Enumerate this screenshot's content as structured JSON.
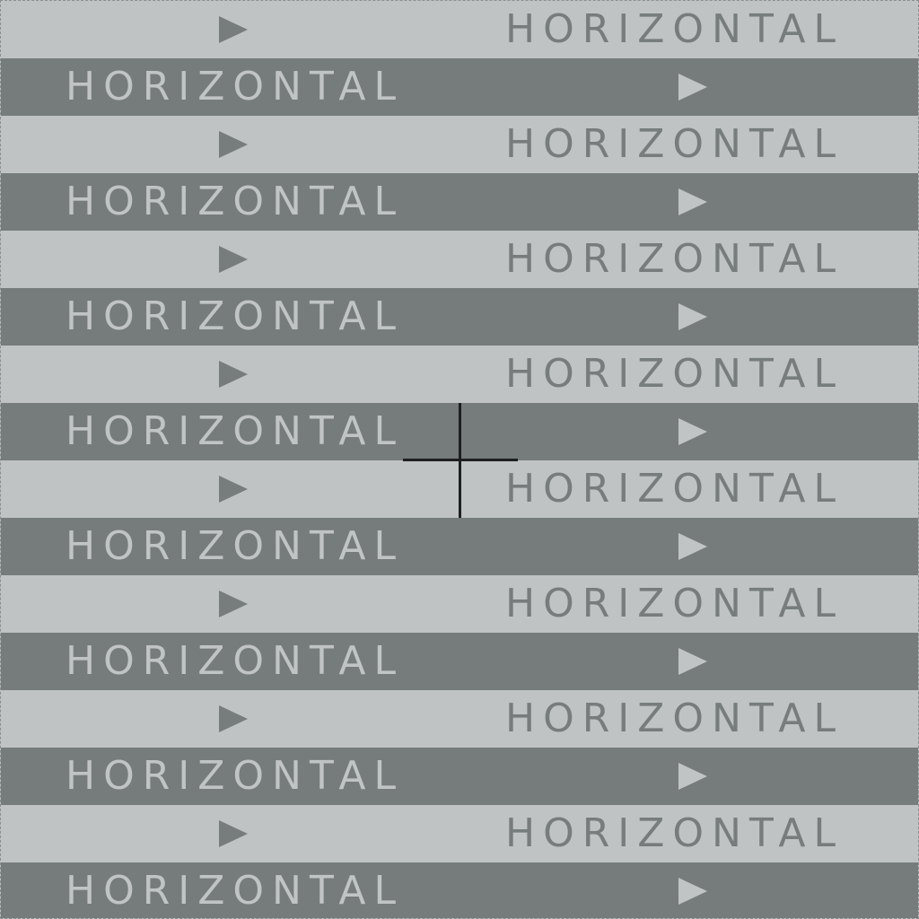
{
  "pattern": {
    "word": "HORIZONTAL",
    "arrow_icon": "play-arrow-icon",
    "stripe_count": 16,
    "first_stripe": "light"
  },
  "colors": {
    "light_stripe_bg": "#bfc3c4",
    "light_stripe_fg": "#777c7d",
    "dark_stripe_bg": "#767b7c",
    "dark_stripe_fg": "#c0c4c5",
    "crosshair": "#1d1f20"
  },
  "overlay": {
    "icon": "crosshair-icon"
  }
}
